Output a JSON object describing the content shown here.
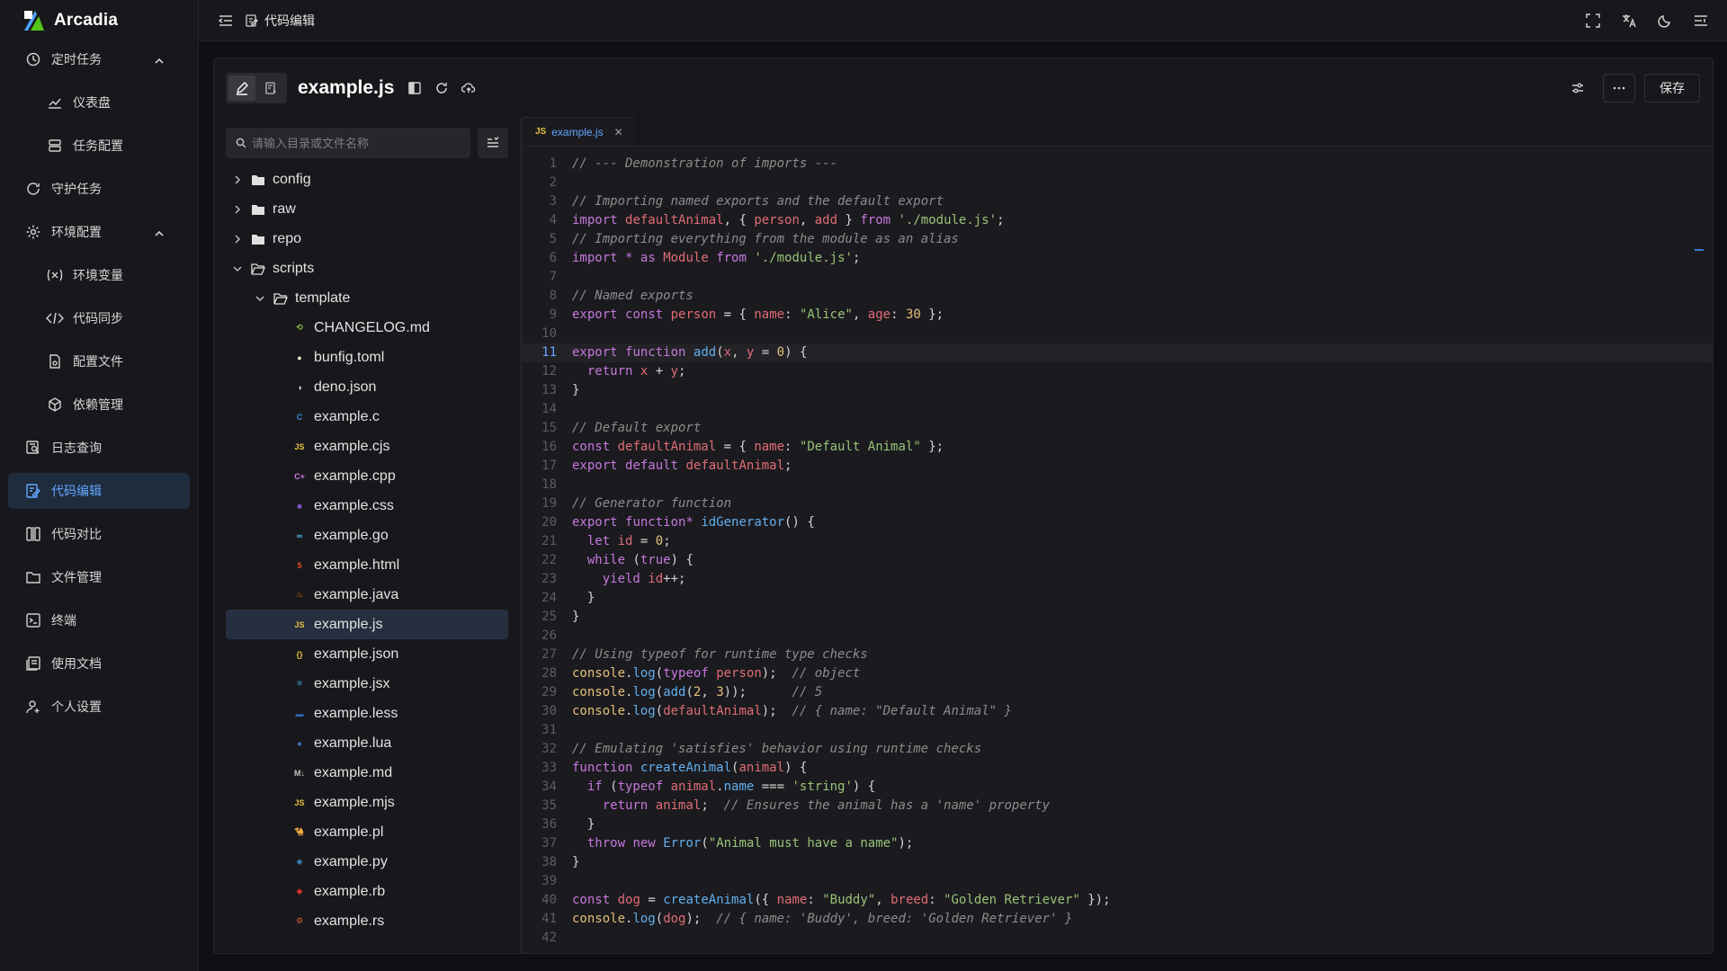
{
  "brand": {
    "name": "Arcadia"
  },
  "sidebar": {
    "items": [
      {
        "label": "定时任务",
        "icon": "clock-icon",
        "caret": "up"
      },
      {
        "label": "仪表盘",
        "icon": "chart-line-icon",
        "sub": true
      },
      {
        "label": "任务配置",
        "icon": "database-icon",
        "sub": true
      },
      {
        "label": "守护任务",
        "icon": "refresh-icon"
      },
      {
        "label": "环境配置",
        "icon": "gear-icon",
        "caret": "up"
      },
      {
        "label": "环境变量",
        "icon": "variable-icon",
        "sub": true
      },
      {
        "label": "代码同步",
        "icon": "code-sync-icon",
        "sub": true
      },
      {
        "label": "配置文件",
        "icon": "file-settings-icon",
        "sub": true
      },
      {
        "label": "依赖管理",
        "icon": "package-icon",
        "sub": true
      },
      {
        "label": "日志查询",
        "icon": "log-search-icon"
      },
      {
        "label": "代码编辑",
        "icon": "code-edit-icon",
        "active": true
      },
      {
        "label": "代码对比",
        "icon": "diff-icon"
      },
      {
        "label": "文件管理",
        "icon": "folder-icon"
      },
      {
        "label": "终端",
        "icon": "terminal-icon"
      },
      {
        "label": "使用文档",
        "icon": "docs-icon"
      },
      {
        "label": "个人设置",
        "icon": "user-settings-icon"
      }
    ]
  },
  "header": {
    "title": "代码编辑"
  },
  "toolbar": {
    "file_title": "example.js",
    "save_label": "保存"
  },
  "search": {
    "placeholder": "请输入目录或文件名称"
  },
  "tree": [
    {
      "name": "config",
      "type": "folder",
      "depth": 0,
      "open": false
    },
    {
      "name": "raw",
      "type": "folder",
      "depth": 0,
      "open": false
    },
    {
      "name": "repo",
      "type": "folder",
      "depth": 0,
      "open": false
    },
    {
      "name": "scripts",
      "type": "folder",
      "depth": 0,
      "open": true
    },
    {
      "name": "template",
      "type": "folder",
      "depth": 1,
      "open": true
    },
    {
      "name": "CHANGELOG.md",
      "type": "file",
      "depth": 2,
      "icon": "changelog-icon",
      "color": "#8bc34a"
    },
    {
      "name": "bunfig.toml",
      "type": "file",
      "depth": 2,
      "icon": "bun-icon",
      "color": "#f5e6d3"
    },
    {
      "name": "deno.json",
      "type": "file",
      "depth": 2,
      "icon": "deno-icon",
      "color": "#e5e5e5"
    },
    {
      "name": "example.c",
      "type": "file",
      "depth": 2,
      "icon": "c-icon",
      "color": "#3c8dd8"
    },
    {
      "name": "example.cjs",
      "type": "file",
      "depth": 2,
      "icon": "js-icon",
      "color": "#e8c13d"
    },
    {
      "name": "example.cpp",
      "type": "file",
      "depth": 2,
      "icon": "cpp-icon",
      "color": "#c678dd"
    },
    {
      "name": "example.css",
      "type": "file",
      "depth": 2,
      "icon": "css-icon",
      "color": "#7e57c2"
    },
    {
      "name": "example.go",
      "type": "file",
      "depth": 2,
      "icon": "go-icon",
      "color": "#4fc3f7"
    },
    {
      "name": "example.html",
      "type": "file",
      "depth": 2,
      "icon": "html-icon",
      "color": "#e44d26"
    },
    {
      "name": "example.java",
      "type": "file",
      "depth": 2,
      "icon": "java-icon",
      "color": "#e76f00"
    },
    {
      "name": "example.js",
      "type": "file",
      "depth": 2,
      "icon": "js-icon",
      "color": "#e8c13d",
      "selected": true
    },
    {
      "name": "example.json",
      "type": "file",
      "depth": 2,
      "icon": "json-icon",
      "color": "#e8c13d"
    },
    {
      "name": "example.jsx",
      "type": "file",
      "depth": 2,
      "icon": "react-icon",
      "color": "#4fc3f7"
    },
    {
      "name": "example.less",
      "type": "file",
      "depth": 2,
      "icon": "less-icon",
      "color": "#2a6bb7"
    },
    {
      "name": "example.lua",
      "type": "file",
      "depth": 2,
      "icon": "lua-icon",
      "color": "#3d7bd9"
    },
    {
      "name": "example.md",
      "type": "file",
      "depth": 2,
      "icon": "markdown-icon",
      "color": "#c0c0c0"
    },
    {
      "name": "example.mjs",
      "type": "file",
      "depth": 2,
      "icon": "js-icon",
      "color": "#e8c13d"
    },
    {
      "name": "example.pl",
      "type": "file",
      "depth": 2,
      "icon": "perl-icon",
      "color": "#9aa4c8"
    },
    {
      "name": "example.py",
      "type": "file",
      "depth": 2,
      "icon": "python-icon",
      "color": "#3776ab"
    },
    {
      "name": "example.rb",
      "type": "file",
      "depth": 2,
      "icon": "ruby-icon",
      "color": "#cc342d"
    },
    {
      "name": "example.rs",
      "type": "file",
      "depth": 2,
      "icon": "rust-icon",
      "color": "#e05a36"
    }
  ],
  "editor": {
    "tab_label": "example.js",
    "tab_badge": "JS",
    "current_line": 11,
    "lines": [
      "// --- Demonstration of imports ---",
      "",
      "// Importing named exports and the default export",
      "import defaultAnimal, { person, add } from './module.js';",
      "// Importing everything from the module as an alias",
      "import * as Module from './module.js';",
      "",
      "// Named exports",
      "export const person = { name: \"Alice\", age: 30 };",
      "",
      "export function add(x, y = 0) {",
      "  return x + y;",
      "}",
      "",
      "// Default export",
      "const defaultAnimal = { name: \"Default Animal\" };",
      "export default defaultAnimal;",
      "",
      "// Generator function",
      "export function* idGenerator() {",
      "  let id = 0;",
      "  while (true) {",
      "    yield id++;",
      "  }",
      "}",
      "",
      "// Using typeof for runtime type checks",
      "console.log(typeof person);  // object",
      "console.log(add(2, 3));      // 5",
      "console.log(defaultAnimal);  // { name: \"Default Animal\" }",
      "",
      "// Emulating 'satisfies' behavior using runtime checks",
      "function createAnimal(animal) {",
      "  if (typeof animal.name === 'string') {",
      "    return animal;  // Ensures the animal has a 'name' property",
      "  }",
      "  throw new Error(\"Animal must have a name\");",
      "}",
      "",
      "const dog = createAnimal({ name: \"Buddy\", breed: \"Golden Retriever\" });",
      "console.log(dog);  // { name: 'Buddy', breed: 'Golden Retriever' }",
      ""
    ]
  },
  "colors": {
    "accent": "#63a6ff",
    "active_bg": "#1f2c3e",
    "selected_bg": "#262f40",
    "background": "#101014",
    "panel": "#18181c"
  }
}
